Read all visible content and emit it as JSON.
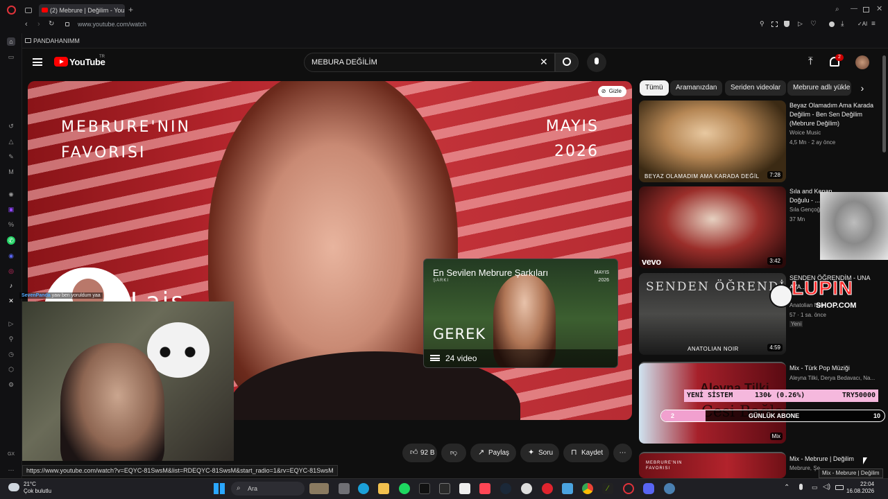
{
  "browser": {
    "tab_title": "(2) Mebrure | Değilim - You",
    "url": "www.youtube.com/watch",
    "bookmark": "PANDAHANIMM"
  },
  "youtube": {
    "logo_text": "YouTube",
    "region": "TR",
    "search_value": "MEBURA DEĞİLİM",
    "notification_count": "2"
  },
  "player": {
    "title_line1": "MEBRURE'NIN",
    "title_line2": "FAVORISI",
    "date_line1": "MAYIS",
    "date_line2": "2026",
    "hide_label": "Gizle",
    "overlay_text": "Lais",
    "playlist_card": {
      "title": "En Sevilen Mebrure Şarkıları",
      "subtitle": "ŞARKI",
      "month": "MAYIS",
      "year": "2026",
      "big_text": "GEREK",
      "count": "24 video"
    }
  },
  "chat": {
    "user": "SevenPanda",
    "message": "yaw ben yoruldum yaa"
  },
  "actions": {
    "like_count": "92 B",
    "share": "Paylaş",
    "ask": "Soru",
    "save": "Kaydet"
  },
  "status_url": "https://www.youtube.com/watch?v=EQYC-81SwsM&list=RDEQYC-81SwsM&start_radio=1&rv=EQYC-81SwsM",
  "chips": [
    "Tümü",
    "Aramanızdan",
    "Seriden videolar",
    "Mebrure adlı yükle"
  ],
  "recommendations": [
    {
      "title": "Beyaz Olamadım Ama Karada Değilim - Ben Sen Değilim (Mebrure Değilim)",
      "channel": "Woice Music",
      "meta": "4,5 Mn · 2 ay önce",
      "duration": "7:28",
      "caption": "BEYAZ OLAMADIM AMA KARADA DEĞİL"
    },
    {
      "title": "Sıla and Kenan Doğulu - ...dan sonra",
      "channel": "Sıla Gençoğlu",
      "meta": "37 Mn",
      "duration": "3:42",
      "caption": "vevo"
    },
    {
      "title": "SENDEN ÖĞRENDİM - UNA AYA...",
      "channel": "Anatolian Noir",
      "meta": "57 · 1 sa. önce",
      "badge": "Yeni",
      "duration": "4:59",
      "caption": "SENDEN ÖĞRENDİM",
      "sub_caption": "ANATOLIAN NOIR"
    },
    {
      "title": "Mix - Türk Pop Müziği",
      "channel": "Aleyna Tilki, Derya Bedavacı, Na...",
      "duration": "Mix",
      "caption": "Aleyna Tilki",
      "caption2": "Cesi Bağları"
    },
    {
      "title": "Mix - Mebrure | Değilim",
      "channel": "Mebrure, Şer...",
      "caption": "MEBRURE'NIN FAVORISI"
    }
  ],
  "overlays": {
    "lupin": "LUPIN",
    "lupin_shop": "SHOP.COM",
    "ticker_left": "YENİ SİSTEM",
    "ticker_mid": "130₺ (0.26%)",
    "ticker_right": "TRY50000",
    "abone_label": "GÜNLÜK ABONE",
    "abone_start": "2",
    "abone_end": "10",
    "abone_progress": 0.2,
    "tooltip": "Mix - Mebrure | Değilim"
  },
  "taskbar": {
    "temp": "21°C",
    "weather": "Çok bulutlu",
    "search": "Ara",
    "time": "22:04",
    "date": "16.08.2026"
  },
  "colors": {
    "youtube_red": "#ff0000",
    "ticker_pink": "#f5b8dd",
    "lupin_red": "#ff2d2d"
  }
}
